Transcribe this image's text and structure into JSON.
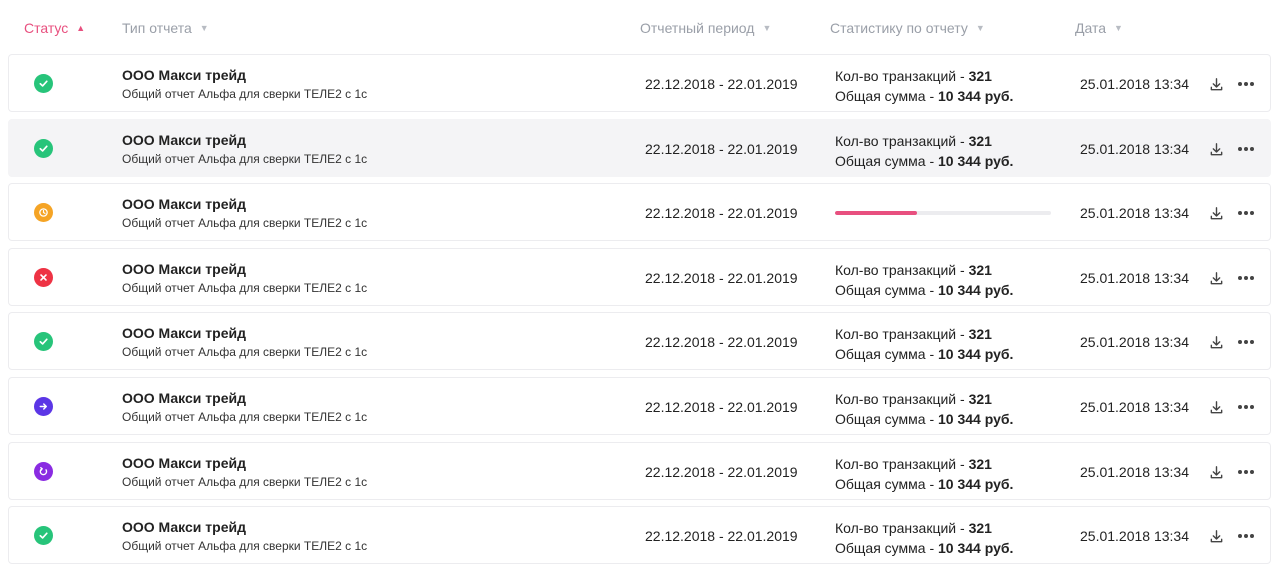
{
  "header": {
    "status": "Статус",
    "report_type": "Тип отчета",
    "period": "Отчетный период",
    "stats": "Статистику по отчету",
    "date": "Дата"
  },
  "colors": {
    "accent": "#e8507f",
    "success": "#27c47a",
    "pending": "#f5a425",
    "error": "#ee3344",
    "forward": "#5b36e6",
    "refresh": "#8a2be2"
  },
  "rows": [
    {
      "status": "success",
      "status_icon": "check-icon",
      "company": "ООО Макси трейд",
      "report_type": "Общий отчет Альфа для сверки ТЕЛЕ2 с 1с",
      "period": "22.12.2018 - 22.01.2019",
      "tx_label": "Кол-во транзакций - ",
      "tx_value": "321",
      "sum_label": "Общая сумма - ",
      "sum_value": "10 344 руб.",
      "date": "25.01.2018 13:34"
    },
    {
      "status": "success",
      "status_icon": "check-icon",
      "company": "ООО Макси трейд",
      "report_type": "Общий отчет Альфа для сверки ТЕЛЕ2 с 1с",
      "period": "22.12.2018 - 22.01.2019",
      "tx_label": "Кол-во транзакций - ",
      "tx_value": "321",
      "sum_label": "Общая сумма - ",
      "sum_value": "10 344 руб.",
      "date": "25.01.2018 13:34"
    },
    {
      "status": "pending",
      "status_icon": "clock-icon",
      "company": "ООО Макси трейд",
      "report_type": "Общий отчет Альфа для сверки ТЕЛЕ2 с 1с",
      "period": "22.12.2018 - 22.01.2019",
      "progress": 0.38,
      "date": "25.01.2018 13:34"
    },
    {
      "status": "error",
      "status_icon": "close-icon",
      "company": "ООО Макси трейд",
      "report_type": "Общий отчет Альфа для сверки ТЕЛЕ2 с 1с",
      "period": "22.12.2018 - 22.01.2019",
      "tx_label": "Кол-во транзакций - ",
      "tx_value": "321",
      "sum_label": "Общая сумма - ",
      "sum_value": "10 344 руб.",
      "date": "25.01.2018 13:34"
    },
    {
      "status": "success",
      "status_icon": "check-icon",
      "company": "ООО Макси трейд",
      "report_type": "Общий отчет Альфа для сверки ТЕЛЕ2 с 1с",
      "period": "22.12.2018 - 22.01.2019",
      "tx_label": "Кол-во транзакций - ",
      "tx_value": "321",
      "sum_label": "Общая сумма - ",
      "sum_value": "10 344 руб.",
      "date": "25.01.2018 13:34"
    },
    {
      "status": "forward",
      "status_icon": "arrow-right-icon",
      "company": "ООО Макси трейд",
      "report_type": "Общий отчет Альфа для сверки ТЕЛЕ2 с 1с",
      "period": "22.12.2018 - 22.01.2019",
      "tx_label": "Кол-во транзакций - ",
      "tx_value": "321",
      "sum_label": "Общая сумма - ",
      "sum_value": "10 344 руб.",
      "date": "25.01.2018 13:34"
    },
    {
      "status": "refresh",
      "status_icon": "refresh-icon",
      "company": "ООО Макси трейд",
      "report_type": "Общий отчет Альфа для сверки ТЕЛЕ2 с 1с",
      "period": "22.12.2018 - 22.01.2019",
      "tx_label": "Кол-во транзакций - ",
      "tx_value": "321",
      "sum_label": "Общая сумма - ",
      "sum_value": "10 344 руб.",
      "date": "25.01.2018 13:34"
    },
    {
      "status": "success",
      "status_icon": "check-icon",
      "company": "ООО Макси трейд",
      "report_type": "Общий отчет Альфа для сверки ТЕЛЕ2 с 1с",
      "period": "22.12.2018 - 22.01.2019",
      "tx_label": "Кол-во транзакций - ",
      "tx_value": "321",
      "sum_label": "Общая сумма - ",
      "sum_value": "10 344 руб.",
      "date": "25.01.2018 13:34"
    }
  ]
}
